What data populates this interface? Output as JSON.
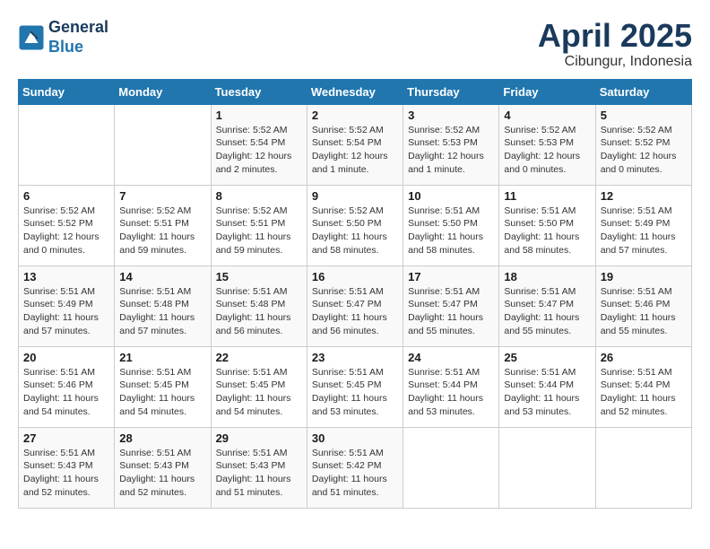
{
  "header": {
    "logo_line1": "General",
    "logo_line2": "Blue",
    "month": "April 2025",
    "location": "Cibungur, Indonesia"
  },
  "weekdays": [
    "Sunday",
    "Monday",
    "Tuesday",
    "Wednesday",
    "Thursday",
    "Friday",
    "Saturday"
  ],
  "weeks": [
    [
      {
        "day": "",
        "text": ""
      },
      {
        "day": "",
        "text": ""
      },
      {
        "day": "1",
        "text": "Sunrise: 5:52 AM\nSunset: 5:54 PM\nDaylight: 12 hours\nand 2 minutes."
      },
      {
        "day": "2",
        "text": "Sunrise: 5:52 AM\nSunset: 5:54 PM\nDaylight: 12 hours\nand 1 minute."
      },
      {
        "day": "3",
        "text": "Sunrise: 5:52 AM\nSunset: 5:53 PM\nDaylight: 12 hours\nand 1 minute."
      },
      {
        "day": "4",
        "text": "Sunrise: 5:52 AM\nSunset: 5:53 PM\nDaylight: 12 hours\nand 0 minutes."
      },
      {
        "day": "5",
        "text": "Sunrise: 5:52 AM\nSunset: 5:52 PM\nDaylight: 12 hours\nand 0 minutes."
      }
    ],
    [
      {
        "day": "6",
        "text": "Sunrise: 5:52 AM\nSunset: 5:52 PM\nDaylight: 12 hours\nand 0 minutes."
      },
      {
        "day": "7",
        "text": "Sunrise: 5:52 AM\nSunset: 5:51 PM\nDaylight: 11 hours\nand 59 minutes."
      },
      {
        "day": "8",
        "text": "Sunrise: 5:52 AM\nSunset: 5:51 PM\nDaylight: 11 hours\nand 59 minutes."
      },
      {
        "day": "9",
        "text": "Sunrise: 5:52 AM\nSunset: 5:50 PM\nDaylight: 11 hours\nand 58 minutes."
      },
      {
        "day": "10",
        "text": "Sunrise: 5:51 AM\nSunset: 5:50 PM\nDaylight: 11 hours\nand 58 minutes."
      },
      {
        "day": "11",
        "text": "Sunrise: 5:51 AM\nSunset: 5:50 PM\nDaylight: 11 hours\nand 58 minutes."
      },
      {
        "day": "12",
        "text": "Sunrise: 5:51 AM\nSunset: 5:49 PM\nDaylight: 11 hours\nand 57 minutes."
      }
    ],
    [
      {
        "day": "13",
        "text": "Sunrise: 5:51 AM\nSunset: 5:49 PM\nDaylight: 11 hours\nand 57 minutes."
      },
      {
        "day": "14",
        "text": "Sunrise: 5:51 AM\nSunset: 5:48 PM\nDaylight: 11 hours\nand 57 minutes."
      },
      {
        "day": "15",
        "text": "Sunrise: 5:51 AM\nSunset: 5:48 PM\nDaylight: 11 hours\nand 56 minutes."
      },
      {
        "day": "16",
        "text": "Sunrise: 5:51 AM\nSunset: 5:47 PM\nDaylight: 11 hours\nand 56 minutes."
      },
      {
        "day": "17",
        "text": "Sunrise: 5:51 AM\nSunset: 5:47 PM\nDaylight: 11 hours\nand 55 minutes."
      },
      {
        "day": "18",
        "text": "Sunrise: 5:51 AM\nSunset: 5:47 PM\nDaylight: 11 hours\nand 55 minutes."
      },
      {
        "day": "19",
        "text": "Sunrise: 5:51 AM\nSunset: 5:46 PM\nDaylight: 11 hours\nand 55 minutes."
      }
    ],
    [
      {
        "day": "20",
        "text": "Sunrise: 5:51 AM\nSunset: 5:46 PM\nDaylight: 11 hours\nand 54 minutes."
      },
      {
        "day": "21",
        "text": "Sunrise: 5:51 AM\nSunset: 5:45 PM\nDaylight: 11 hours\nand 54 minutes."
      },
      {
        "day": "22",
        "text": "Sunrise: 5:51 AM\nSunset: 5:45 PM\nDaylight: 11 hours\nand 54 minutes."
      },
      {
        "day": "23",
        "text": "Sunrise: 5:51 AM\nSunset: 5:45 PM\nDaylight: 11 hours\nand 53 minutes."
      },
      {
        "day": "24",
        "text": "Sunrise: 5:51 AM\nSunset: 5:44 PM\nDaylight: 11 hours\nand 53 minutes."
      },
      {
        "day": "25",
        "text": "Sunrise: 5:51 AM\nSunset: 5:44 PM\nDaylight: 11 hours\nand 53 minutes."
      },
      {
        "day": "26",
        "text": "Sunrise: 5:51 AM\nSunset: 5:44 PM\nDaylight: 11 hours\nand 52 minutes."
      }
    ],
    [
      {
        "day": "27",
        "text": "Sunrise: 5:51 AM\nSunset: 5:43 PM\nDaylight: 11 hours\nand 52 minutes."
      },
      {
        "day": "28",
        "text": "Sunrise: 5:51 AM\nSunset: 5:43 PM\nDaylight: 11 hours\nand 52 minutes."
      },
      {
        "day": "29",
        "text": "Sunrise: 5:51 AM\nSunset: 5:43 PM\nDaylight: 11 hours\nand 51 minutes."
      },
      {
        "day": "30",
        "text": "Sunrise: 5:51 AM\nSunset: 5:42 PM\nDaylight: 11 hours\nand 51 minutes."
      },
      {
        "day": "",
        "text": ""
      },
      {
        "day": "",
        "text": ""
      },
      {
        "day": "",
        "text": ""
      }
    ]
  ]
}
